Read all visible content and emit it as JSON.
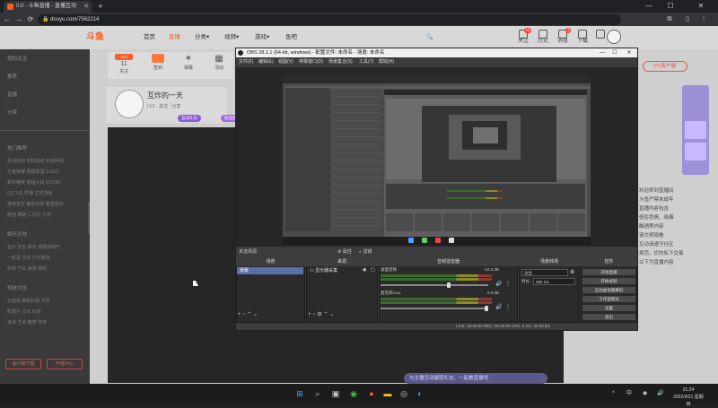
{
  "browser": {
    "tab_title": "0.0 - 斗鱼直播 - 直播互动",
    "url": "douyu.com/7562214"
  },
  "site": {
    "logo": "斗鱼",
    "nav": [
      "首页",
      "直播",
      "分类▾",
      "视频▾",
      "游戏▾",
      "鱼吧"
    ],
    "header_icons": [
      {
        "label": "关注",
        "badge": "19"
      },
      {
        "label": "历史",
        "badge": ""
      },
      {
        "label": "消息",
        "badge": "2"
      },
      {
        "label": "下载",
        "badge": ""
      },
      {
        "label": "开播",
        "badge": ""
      }
    ]
  },
  "room": {
    "toolbar": [
      {
        "label": "11",
        "sub": "关注"
      },
      {
        "label": "",
        "sub": "签到"
      },
      {
        "label": "✶",
        "sub": "弹幕"
      },
      {
        "label": "▦",
        "sub": "活动"
      }
    ],
    "streamer_name": "互炸的一天",
    "sub_info": "LV1  · 关注 · 分享",
    "pills": [
      "互动礼包",
      "粉丝团"
    ],
    "chat_hint": "与主播互动赢取礼包，一起看直播吧"
  },
  "sidebar": {
    "sections": [
      {
        "title": "我的关注",
        "rows": []
      },
      {
        "title": "推荐",
        "rows": []
      },
      {
        "title": "直播",
        "rows": []
      },
      {
        "title": "分类",
        "rows": []
      },
      {
        "title": "热门推荐",
        "rows": [
          "互动游戏  单机游戏  手游休闲",
          "王者荣耀  英雄联盟  CSGO",
          "和平精英  穿越火线  DOTA2",
          "QQ飞车  原神  主机游戏",
          "绝地求生  魔兽世界  暴雪游戏",
          "颜值  舞蹈  二次元  户外"
        ]
      },
      {
        "title": "娱乐天地",
        "rows": [
          "音乐  交友  聊天  视频放映厅",
          "一起看  文化  户外旅游",
          "科技  汽车  美食  数码"
        ]
      },
      {
        "title": "科技文化",
        "rows": [
          "云游戏  数码科技  汽车",
          "纪录片  文化  科普",
          "读书  艺术  教育  体育"
        ]
      }
    ],
    "buttons": [
      "客户端下载",
      "开播中心"
    ]
  },
  "right": {
    "pc_badge": "PC客户端",
    "lines": [
      "欢迎来到直播间",
      "斗鱼严禁未成年",
      "直播内容包含",
      "低俗色情、吸烟",
      "酗酒等内容",
      "请文明观看",
      "互动请遵守社区",
      "规范，切勿私下交易",
      "以下为直播内容"
    ]
  },
  "obs": {
    "title": "OBS 28.1.1 (64-bit, windows) - 配置文件: 未命名 - 场景: 未命名",
    "menu": [
      "文件(F)",
      "编辑(E)",
      "视图(V)",
      "停靠窗口(D)",
      "场景集合(S)",
      "工具(T)",
      "帮助(H)"
    ],
    "scene_bar": {
      "label": "未选择源",
      "props": "属性",
      "filters": "滤镜"
    },
    "docks": {
      "scenes": {
        "title": "场景",
        "selected": "场景"
      },
      "sources": {
        "title": "来源",
        "item": "显示器采集"
      },
      "mixer": {
        "title": "音频混音器",
        "channels": [
          {
            "name": "桌面音频",
            "db": "-10.2 dB"
          },
          {
            "name": "麦克风/Aux",
            "db": "0.0 dB"
          }
        ]
      },
      "transitions": {
        "title": "场景转场",
        "type": "淡出",
        "duration_label": "时长",
        "duration": "300 ms"
      },
      "controls": {
        "title": "控件",
        "buttons": [
          "开始直播",
          "开始录制",
          "启动虚拟摄像机",
          "工作室模式",
          "设置",
          "退出"
        ]
      }
    },
    "status": "LIVE: 00:00:00   REC: 00:00:00   CPU: 0.4%, 30.00 fps"
  },
  "taskbar": {
    "tray": [
      "^",
      "中",
      "◉",
      "🔊"
    ],
    "time": "21:24",
    "date": "2022/4/21 星期四"
  }
}
